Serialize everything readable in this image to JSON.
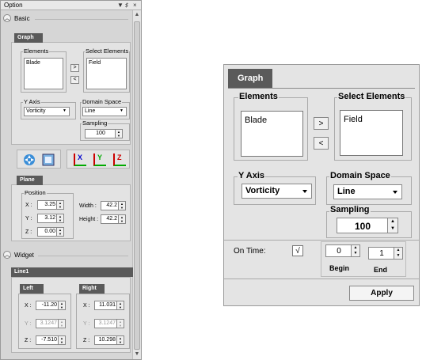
{
  "panel": {
    "title": "Option",
    "title_buttons": [
      "▼",
      "♯",
      "×"
    ],
    "basic": {
      "label": "Basic",
      "tab": "Graph",
      "elements_label": "Elements",
      "elements_items": [
        "Blade"
      ],
      "select_label": "Select Elements",
      "select_items": [
        "Field"
      ],
      "add": ">",
      "remove": "<",
      "yaxis_label": "Y Axis",
      "yaxis_value": "Vorticity",
      "domain_label": "Domain Space",
      "domain_value": "Line",
      "sampling_label": "Sampling",
      "sampling_value": "100"
    },
    "toolbar": {
      "x_label": "X",
      "y_label": "Y",
      "z_label": "Z"
    },
    "plane": {
      "tab": "Plane",
      "position_label": "Position",
      "x_label": "X :",
      "x_value": "3.25",
      "y_label": "Y :",
      "y_value": "3.12",
      "z_label": "Z :",
      "z_value": "0.00",
      "width_label": "Width :",
      "width_value": "42.2",
      "height_label": "Height :",
      "height_value": "42.2"
    },
    "widget": {
      "label": "Widget",
      "tab": "Line1",
      "left_label": "Left",
      "right_label": "Right",
      "left_x_label": "X :",
      "left_x": "-11.20",
      "left_y_label": "Y :",
      "left_y": "3.1247",
      "left_z_label": "Z :",
      "left_z": "-7.510",
      "right_x_label": "X :",
      "right_x": "11.031",
      "right_y_label": "Y :",
      "right_y": "3.1247",
      "right_z_label": "Z :",
      "right_z": "10.298"
    }
  },
  "dialog": {
    "tab": "Graph",
    "elements_label": "Elements",
    "elements_items": [
      "Blade"
    ],
    "select_label": "Select Elements",
    "select_items": [
      "Field"
    ],
    "add": ">",
    "remove": "<",
    "yaxis_label": "Y Axis",
    "yaxis_value": "Vorticity",
    "domain_label": "Domain Space",
    "domain_value": "Line",
    "sampling_label": "Sampling",
    "sampling_value": "100",
    "ontime_label": "On Time:",
    "ontime_check": "√",
    "begin_value": "0",
    "end_value": "1",
    "begin_label": "Begin",
    "end_label": "End",
    "apply_label": "Apply"
  }
}
